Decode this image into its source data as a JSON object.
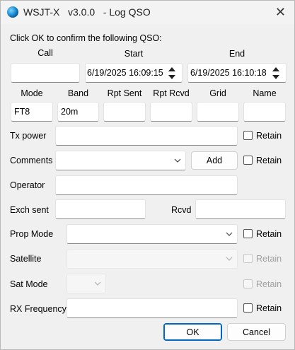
{
  "window": {
    "title": "WSJT-X   v3.0.0   - Log QSO",
    "close_glyph": "✕"
  },
  "prompt": "Click OK to confirm the following QSO:",
  "qso": {
    "call_label": "Call",
    "call_value": "",
    "start_label": "Start",
    "start_value": "6/19/2025 16:09:15",
    "end_label": "End",
    "end_value": "6/19/2025 16:10:18"
  },
  "columns": {
    "mode_label": "Mode",
    "mode_value": "FT8",
    "band_label": "Band",
    "band_value": "20m",
    "rpt_sent_label": "Rpt Sent",
    "rpt_sent_value": "",
    "rpt_rcvd_label": "Rpt Rcvd",
    "rpt_rcvd_value": "",
    "grid_label": "Grid",
    "grid_value": "",
    "name_label": "Name",
    "name_value": ""
  },
  "form": {
    "tx_power_label": "Tx power",
    "tx_power_value": "",
    "tx_power_retain": "Retain",
    "comments_label": "Comments",
    "comments_value": "",
    "add_button": "Add",
    "comments_retain": "Retain",
    "operator_label": "Operator",
    "operator_value": "",
    "exch_sent_label": "Exch sent",
    "exch_sent_value": "",
    "rcvd_label": "Rcvd",
    "rcvd_value": "",
    "prop_mode_label": "Prop Mode",
    "prop_mode_value": "",
    "prop_mode_retain": "Retain",
    "satellite_label": "Satellite",
    "satellite_value": "",
    "satellite_retain": "Retain",
    "sat_mode_label": "Sat Mode",
    "sat_mode_value": "",
    "sat_mode_retain": "Retain",
    "rx_freq_label": "RX Frequency",
    "rx_freq_value": "",
    "rx_freq_retain": "Retain"
  },
  "buttons": {
    "ok": "OK",
    "cancel": "Cancel"
  },
  "colors": {
    "accent": "#0067c0",
    "window_bg": "#f0f0f0",
    "field_bg": "#ffffff"
  }
}
